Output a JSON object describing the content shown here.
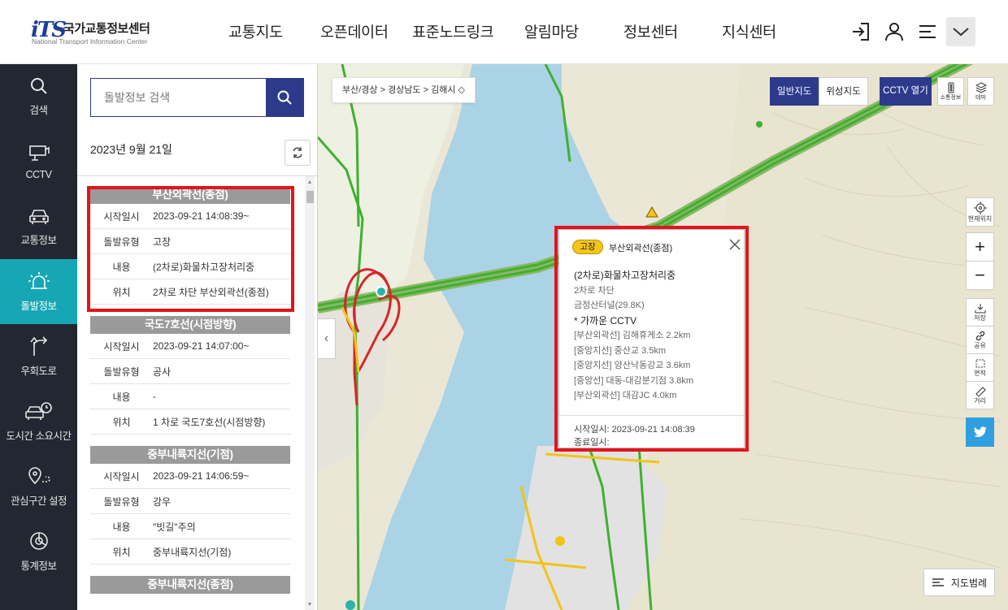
{
  "header": {
    "logo_mark": "iTS",
    "logo_ko": "국가교통정보센터",
    "logo_en": "National Transport Information Center",
    "nav": [
      "교통지도",
      "오픈데이터",
      "표준노드링크",
      "알림마당",
      "정보센터",
      "지식센터"
    ]
  },
  "rail": [
    {
      "label": "검색",
      "icon": "search-icon"
    },
    {
      "label": "CCTV",
      "icon": "cctv-icon"
    },
    {
      "label": "교통정보",
      "icon": "car-icon"
    },
    {
      "label": "돌발정보",
      "icon": "siren-icon",
      "active": true
    },
    {
      "label": "우회도로",
      "icon": "detour-icon"
    },
    {
      "label": "도시간 소요시간",
      "icon": "car-clock-icon"
    },
    {
      "label": "관심구간 설정",
      "icon": "pin-route-icon"
    },
    {
      "label": "통계정보",
      "icon": "chart-icon"
    }
  ],
  "panel": {
    "search_placeholder": "돌발정보 검색",
    "date": "2023년 9월 21일",
    "labels": {
      "start": "시작일시",
      "type": "돌발유형",
      "content": "내용",
      "location": "위치"
    },
    "incidents": [
      {
        "road": "부산외곽선(종점)",
        "start": "2023-09-21  14:08:39~",
        "type": "고장",
        "content": "(2차로)화물차고장처리중",
        "location": "2차로 차단  부산외곽선(종점)"
      },
      {
        "road": "국도7호선(시점방향)",
        "start": "2023-09-21  14:07:00~",
        "type": "공사",
        "content": "-",
        "location": "1 차로 국도7호선(시점방향)"
      },
      {
        "road": "중부내륙지선(기점)",
        "start": "2023-09-21  14:06:59~",
        "type": "강우",
        "content": "\"빗길\"주의",
        "location": "중부내륙지선(기점)"
      },
      {
        "road": "중부내륙지선(종점)",
        "start": "",
        "type": "",
        "content": "",
        "location": ""
      }
    ]
  },
  "map": {
    "breadcrumb": "부산/경상 > 경상남도 > 김해시 ◇",
    "map_types": [
      "일반지도",
      "위성지도"
    ],
    "cctv_button": "CCTV 열기",
    "tools": [
      "소통정보",
      "테마"
    ],
    "controls": {
      "locate": "현재위치",
      "save": "저장",
      "share": "공유",
      "area": "면적",
      "distance": "거리"
    },
    "legend": "지도범례",
    "popup": {
      "badge": "고장",
      "road": "부산외곽선(종점)",
      "main": "(2차로)화물차고장처리중",
      "lines": [
        "2차로  차단",
        "금정산터널(29.8K)"
      ],
      "cctv_title": "* 가까운 CCTV",
      "cctv": [
        "[부산외곽선] 김해휴게소 2.2km",
        "[중앙지선] 중산교 3.5km",
        "[중앙지선] 양산낙동강교 3.6km",
        "[중앙선] 대동-대감분기점 3.8km",
        "[부산외곽선] 대감JC 4.0km"
      ],
      "start": "시작일시:  2023-09-21  14:08:39",
      "end": "종료일시:"
    }
  },
  "colors": {
    "accent": "#2d3a8c",
    "rail_bg": "#222831",
    "rail_active": "#17a6b4",
    "highlight": "#e3141b",
    "badge": "#f5c518"
  }
}
